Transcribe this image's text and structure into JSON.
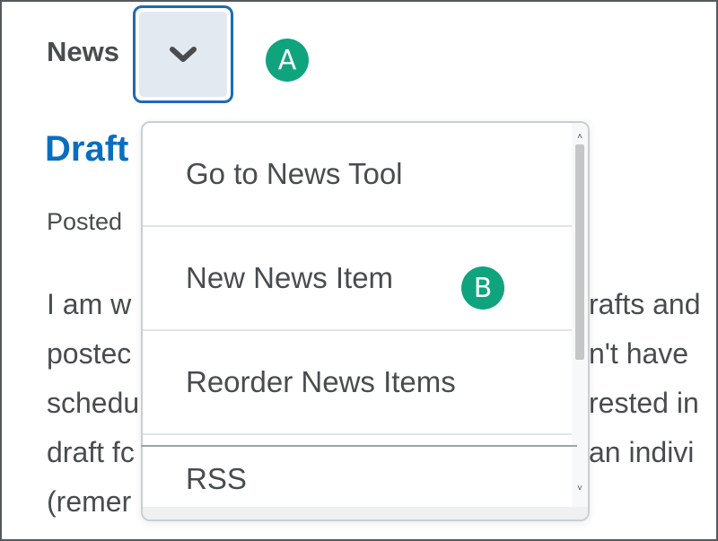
{
  "widget": {
    "title": "News",
    "menu_toggle_icon": "chevron-down-icon"
  },
  "callouts": {
    "a": "A",
    "b": "B"
  },
  "item": {
    "title": "Draft",
    "posted": "Posted"
  },
  "body_lines": [
    {
      "left": "I am w",
      "right": "rafts and"
    },
    {
      "left": "postec",
      "right": "n't have"
    },
    {
      "left": "schedu",
      "right": "rested in"
    },
    {
      "left": "draft fc",
      "right": "an indivi"
    },
    {
      "left": "(remer",
      "right": ""
    }
  ],
  "dropdown": {
    "items": [
      "Go to News Tool",
      "New News Item",
      "Reorder News Items",
      "RSS"
    ]
  },
  "colors": {
    "accent": "#1a6bb8",
    "title_link": "#0a6ec0",
    "callout": "#0fa47e",
    "text": "#494c4e"
  }
}
